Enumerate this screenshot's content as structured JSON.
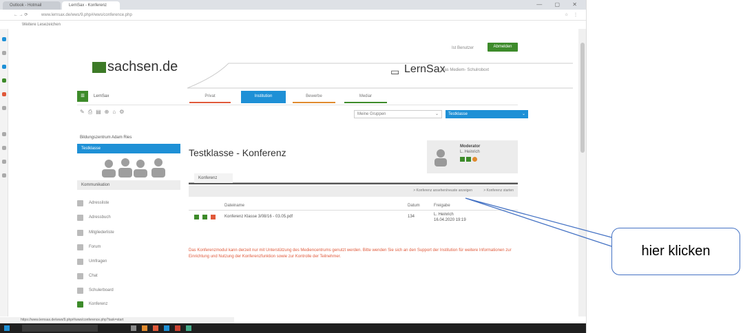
{
  "browser": {
    "tabs": [
      "Outlook - Hotmail",
      "LernSax - Konferenz"
    ],
    "window_controls": "— ▢ ✕",
    "url": "www.lernsax.de/wws/9.php#/wws/conference.php",
    "toolbar_icons": "☆ ⋮",
    "bookmark": "Weitere Lesezeichen"
  },
  "header": {
    "login_link": "Ist Benutzer",
    "login_button": "Abmelden",
    "site_logo": "sachsen.de",
    "product_logo": "LernSax",
    "product_subtitle": "Das Mediem- Schulroboxt"
  },
  "nav": {
    "brand": "LernSax",
    "tabs": [
      {
        "label": "Privat",
        "color": "#e0593a"
      },
      {
        "label": "Institution",
        "color": "#1e90d6"
      },
      {
        "label": "Bewerbe",
        "color": "#e08a2e"
      },
      {
        "label": "Mediar",
        "color": "#3d8b2a"
      }
    ],
    "group_select": "Meine Gruppen",
    "class_select": "Testklasse"
  },
  "sidebar": {
    "institution": "Bildungszentrum Adam Ries",
    "active_item": "Testklasse",
    "section_title": "Kommunikation",
    "items": [
      "Adressliste",
      "Adressbuch",
      "Mitgliederliste",
      "Forum",
      "Umfragen",
      "Chat",
      "Schulerboard",
      "Konferenz"
    ]
  },
  "main": {
    "title": "Testklasse - Konferenz",
    "subtab": "Konferenz",
    "moderator_label": "Moderator",
    "moderator_name": "L. Heinrich",
    "actions_left": "> Konferenz ansehen/neuste anzeigen",
    "actions_right": "> Konferenz starten",
    "table_headers": [
      "Dateiname",
      "Datum",
      "Freigabe"
    ],
    "row": {
      "name": "Konferenz Klasse 3/08/16 - 03.05.pdf",
      "size": "134",
      "by": "L. Heinrich",
      "date": "16.04.2020 19:19"
    },
    "notice": "Das Konferenzmodul kann derzeit nur mit Unterstützung des Mediencentrums genutzt werden. Bitte wenden Sie sich an den Support der Institution für weitere Informationen zur Einrichtung und Nutzung der Konferenzfunktion sowie zur Kontrolle der Teilnehmer."
  },
  "status_bar_url": "https://www.lernsax.de/wws/9.php#/wws/conference.php?task=start",
  "annotation": {
    "callout_text": "hier klicken"
  },
  "colors": {
    "accent": "#1e90d6",
    "green": "#3d8b2a",
    "notice": "#e0593a",
    "callout_border": "#4472c4"
  }
}
